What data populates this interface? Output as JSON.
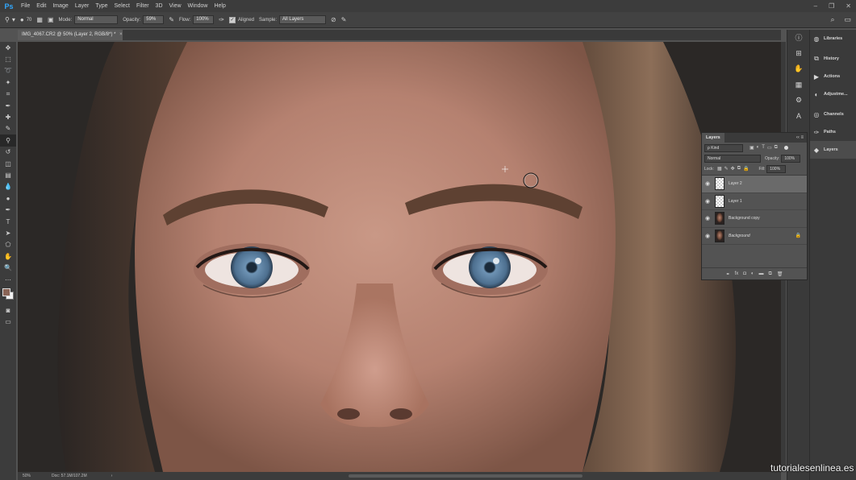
{
  "app": {
    "logo": "Ps"
  },
  "menu": [
    "File",
    "Edit",
    "Image",
    "Layer",
    "Type",
    "Select",
    "Filter",
    "3D",
    "View",
    "Window",
    "Help"
  ],
  "window_controls": [
    "–",
    "❐",
    "✕"
  ],
  "options_bar": {
    "brush_size": "70",
    "mode_label": "Mode:",
    "mode_value": "Normal",
    "opacity_label": "Opacity:",
    "opacity_value": "59%",
    "flow_label": "Flow:",
    "flow_value": "100%",
    "aligned_label": "Aligned",
    "sample_label": "Sample:",
    "sample_value": "All Layers"
  },
  "document_tab": {
    "title": "IMG_4067.CR2 @ 50% (Layer 2, RGB/8*) *",
    "close": "×"
  },
  "status": {
    "zoom": "50%",
    "doc": "Doc: 57.1M/107.2M",
    "arrow": "›"
  },
  "right_panel": {
    "items": [
      {
        "label": "Libraries",
        "icon": "libraries-icon"
      },
      {
        "label": "History",
        "icon": "history-icon"
      },
      {
        "label": "Actions",
        "icon": "actions-icon"
      },
      {
        "label": "Adjustme...",
        "icon": "adjustments-icon"
      },
      {
        "label": "Channels",
        "icon": "channels-icon"
      },
      {
        "label": "Paths",
        "icon": "paths-icon"
      },
      {
        "label": "Layers",
        "icon": "layers-icon"
      }
    ]
  },
  "layers_panel": {
    "tab": "Layers",
    "header_controls": "‹‹ ≡",
    "filter_kind": "ρ Kind",
    "blend_mode": "Normal",
    "opacity_label": "Opacity:",
    "opacity_value": "100%",
    "lock_label": "Lock:",
    "fill_label": "Fill:",
    "fill_value": "100%",
    "layers": [
      {
        "name": "Layer 2",
        "thumb": "transparent",
        "selected": true
      },
      {
        "name": "Layer 1",
        "thumb": "transparent",
        "selected": false
      },
      {
        "name": "Background copy",
        "thumb": "photo",
        "selected": false
      },
      {
        "name": "Background",
        "thumb": "photo",
        "selected": false,
        "locked": true
      }
    ],
    "footer_icons": [
      "link-icon",
      "fx-icon",
      "mask-icon",
      "adjustment-icon",
      "folder-icon",
      "new-layer-icon",
      "trash-icon"
    ]
  },
  "watermark": "tutorialesenlinea.es",
  "colors": {
    "foreground": "#8a6456",
    "background": "#f2f2f2",
    "ps_blue": "#31a8ff"
  }
}
